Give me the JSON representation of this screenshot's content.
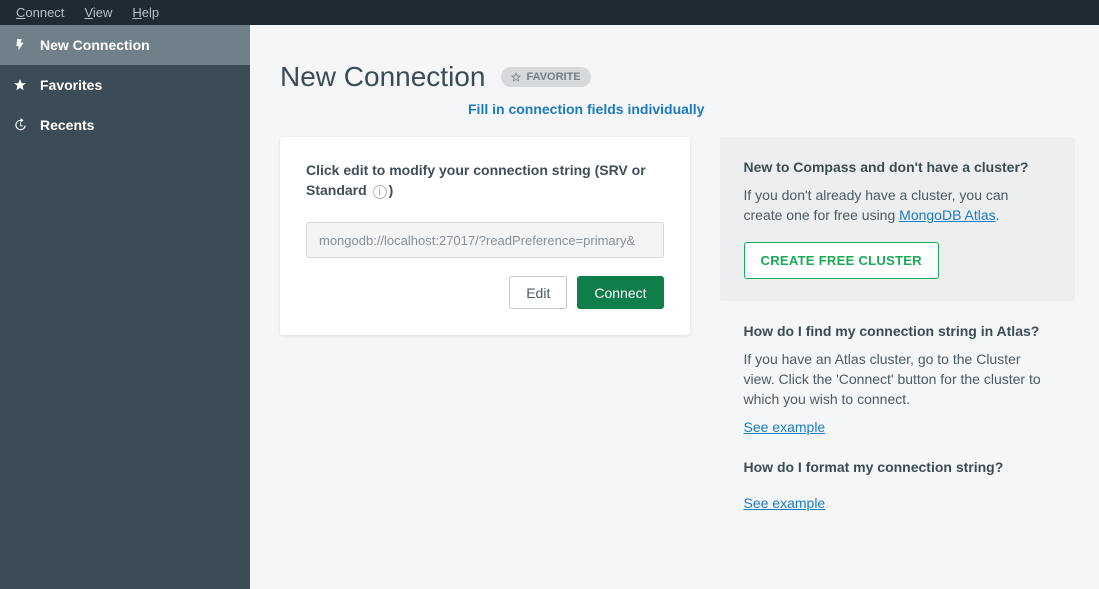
{
  "menubar": {
    "items": [
      "Connect",
      "View",
      "Help"
    ]
  },
  "sidebar": {
    "items": [
      {
        "label": "New Connection"
      },
      {
        "label": "Favorites"
      },
      {
        "label": "Recents"
      }
    ]
  },
  "page": {
    "title": "New Connection",
    "favorite_label": "FAVORITE"
  },
  "fill_link": "Fill in connection fields individually",
  "conn_card": {
    "label_pre": "Click edit to modify your connection string (SRV or Standard ",
    "label_post": ")",
    "placeholder": "mongodb://localhost:27017/?readPreference=primary&",
    "edit_label": "Edit",
    "connect_label": "Connect"
  },
  "help": {
    "box": {
      "title": "New to Compass and don't have a cluster?",
      "text_pre": "If you don't already have a cluster, you can create one for free using ",
      "atlas_link": "MongoDB Atlas",
      "text_post": ".",
      "create_btn": "CREATE FREE CLUSTER"
    },
    "find": {
      "title": "How do I find my connection string in Atlas?",
      "text": "If you have an Atlas cluster, go to the Cluster view. Click the 'Connect' button for the cluster to which you wish to connect.",
      "link": "See example"
    },
    "format": {
      "title": "How do I format my connection string?",
      "link": "See example"
    }
  },
  "colors": {
    "accent_green": "#1aa955",
    "primary_green": "#0f7e4a",
    "link_blue": "#1b7bc2"
  }
}
